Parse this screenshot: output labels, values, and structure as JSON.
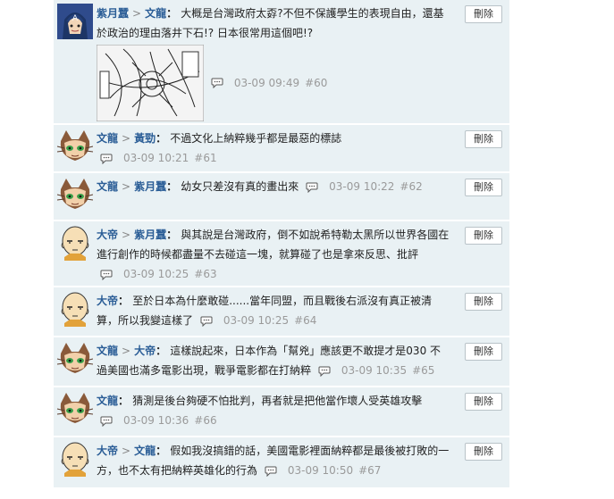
{
  "delete_label": "刪除",
  "comments": [
    {
      "author": "紫月蠶",
      "target": "文龍",
      "text": "大概是台灣政府太孬?不但不保護學生的表現自由，還基於政治的理由落井下石!? 日本很常用這個吧!?",
      "time": "03-09 09:49",
      "floor": "#60",
      "avatar": "hero-avatar",
      "has_image": true
    },
    {
      "author": "文龍",
      "target": "黃勁",
      "text": "不過文化上納粹幾乎都是最惡的標誌",
      "time": "03-09 10:21",
      "floor": "#61",
      "avatar": "cat-avatar"
    },
    {
      "author": "文龍",
      "target": "紫月蠶",
      "text": "幼女只差沒有真的畫出來",
      "time": "03-09 10:22",
      "floor": "#62",
      "avatar": "cat-avatar"
    },
    {
      "author": "大帝",
      "target": "紫月蠶",
      "text": "與其說是台灣政府，倒不如說希特勒太黑所以世界各國在進行創作的時候都盡量不去碰這一塊，就算碰了也是拿來反思、批評",
      "time": "03-09 10:25",
      "floor": "#63",
      "avatar": "bald-avatar"
    },
    {
      "author": "大帝",
      "target": "",
      "text": "至於日本為什麼敢碰......當年同盟，而且戰後右派沒有真正被清算，所以我變這樣了",
      "time": "03-09 10:25",
      "floor": "#64",
      "avatar": "bald-avatar"
    },
    {
      "author": "文龍",
      "target": "大帝",
      "text": "這樣說起來，日本作為「幫兇」應該更不敢提才是030 不過美國也滿多電影出現，戰爭電影都在打納粹",
      "time": "03-09 10:35",
      "floor": "#65",
      "avatar": "cat-avatar"
    },
    {
      "author": "文龍",
      "target": "",
      "text": "猜測是後台夠硬不怕批判，再者就是把他當作壞人受英雄攻擊",
      "time": "03-09 10:36",
      "floor": "#66",
      "avatar": "cat-avatar"
    },
    {
      "author": "大帝",
      "target": "文龍",
      "text": "假如我沒搞錯的話，美國電影裡面納粹都是最後被打敗的一方，也不太有把納粹英雄化的行為",
      "time": "03-09 10:50",
      "floor": "#67",
      "avatar": "bald-avatar"
    }
  ]
}
